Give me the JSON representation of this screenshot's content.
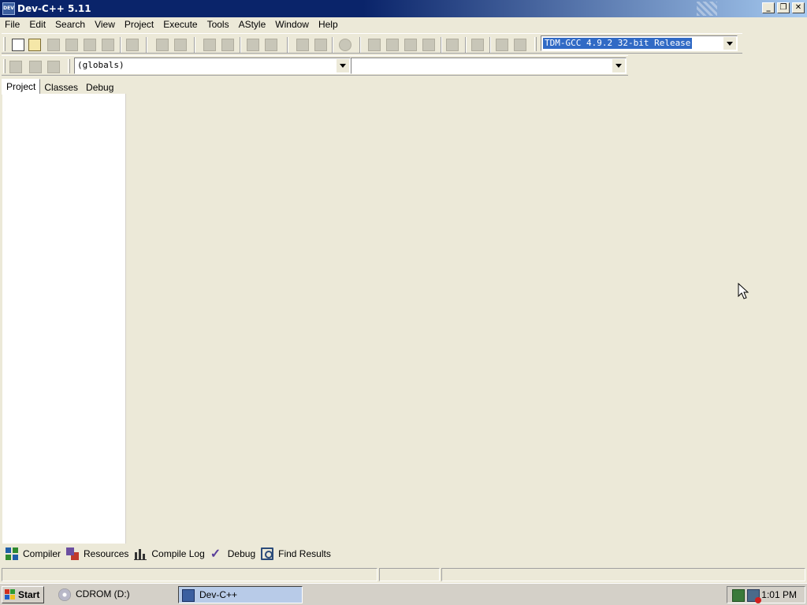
{
  "window": {
    "title": "Dev-C++ 5.11",
    "icon": "devcpp-app-icon",
    "icon_text": "DEV",
    "controls": {
      "minimize": "_",
      "restore": "❐",
      "close": "✕"
    }
  },
  "menu": [
    {
      "label": "File"
    },
    {
      "label": "Edit"
    },
    {
      "label": "Search"
    },
    {
      "label": "View"
    },
    {
      "label": "Project"
    },
    {
      "label": "Execute"
    },
    {
      "label": "Tools"
    },
    {
      "label": "AStyle"
    },
    {
      "label": "Window"
    },
    {
      "label": "Help"
    }
  ],
  "toolbar": {
    "compiler_select": {
      "value": "TDM-GCC 4.9.2 32-bit Release"
    },
    "scope_select": {
      "value": "(globals)"
    },
    "members_select": {
      "value": ""
    }
  },
  "left_panel": {
    "tabs": [
      {
        "label": "Project",
        "active": true
      },
      {
        "label": "Classes",
        "active": false
      },
      {
        "label": "Debug",
        "active": false
      }
    ]
  },
  "bottom_tabs": [
    {
      "label": "Compiler",
      "icon": "compiler-grid-icon"
    },
    {
      "label": "Resources",
      "icon": "resources-icon"
    },
    {
      "label": "Compile Log",
      "icon": "compile-log-chart-icon"
    },
    {
      "label": "Debug",
      "icon": "debug-check-icon"
    },
    {
      "label": "Find Results",
      "icon": "find-results-icon"
    }
  ],
  "taskbar": {
    "start_label": "Start",
    "items": [
      {
        "label": "CDROM (D:)",
        "active": false
      },
      {
        "label": "Dev-C++",
        "active": true
      }
    ],
    "clock": "1:01 PM"
  },
  "colors": {
    "title_bar": "#0a246a",
    "window_bg": "#ece9d8",
    "selection": "#316ac5",
    "taskbar": "#d4d0c8"
  }
}
